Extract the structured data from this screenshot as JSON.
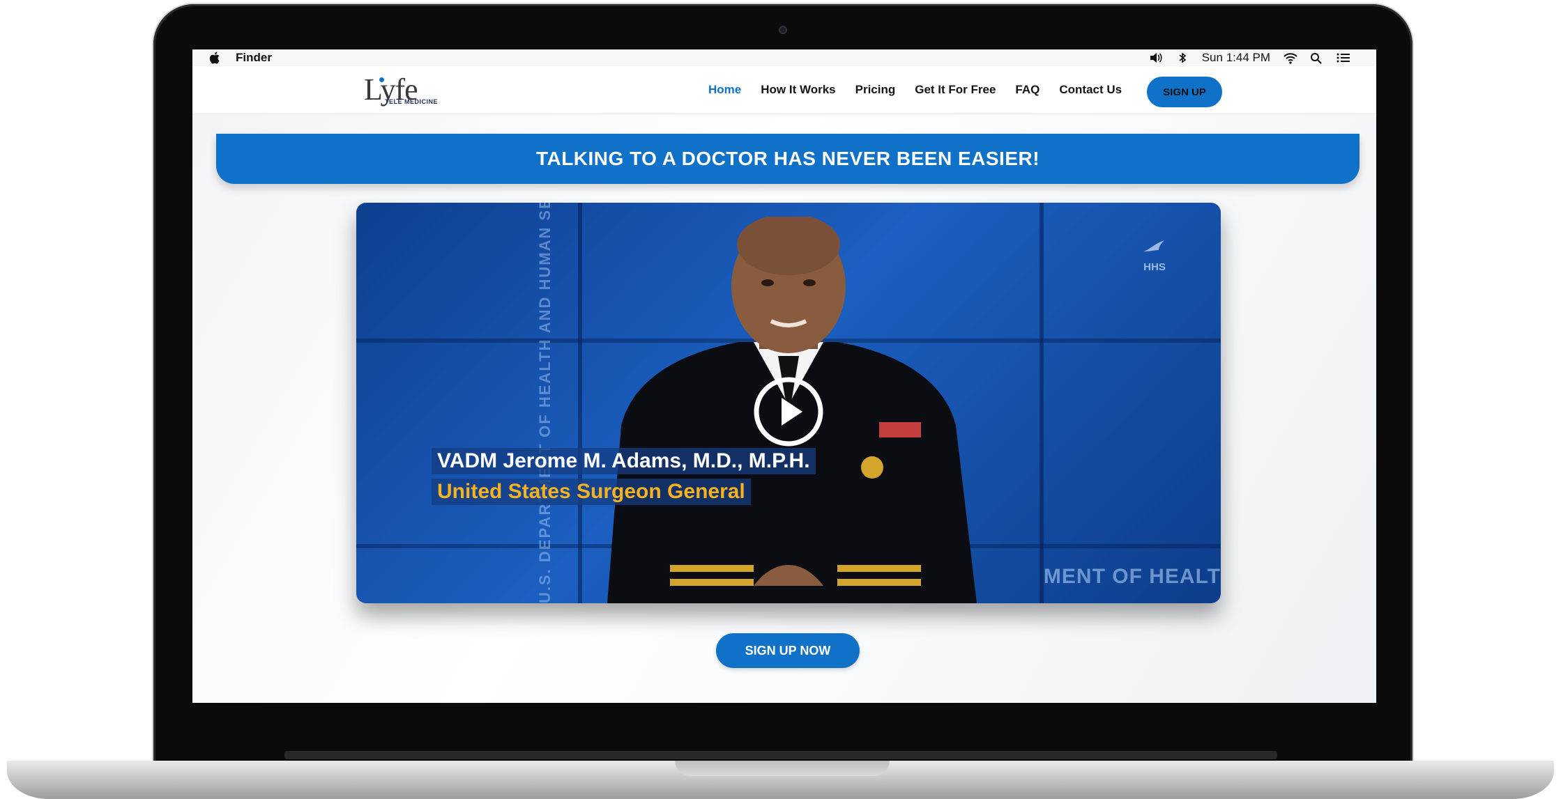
{
  "menubar": {
    "app_name": "Finder",
    "clock": "Sun 1:44 PM"
  },
  "site": {
    "logo": {
      "main": "Lyfe",
      "sub": "TELE MEDICINE"
    },
    "nav": [
      {
        "label": "Home",
        "active": true
      },
      {
        "label": "How It Works",
        "active": false
      },
      {
        "label": "Pricing",
        "active": false
      },
      {
        "label": "Get It For Free",
        "active": false
      },
      {
        "label": "FAQ",
        "active": false
      },
      {
        "label": "Contact Us",
        "active": false
      }
    ],
    "signup_label": "SIGN UP"
  },
  "hero": {
    "banner": "TALKING TO A DOCTOR HAS NEVER BEEN EASIER!",
    "video": {
      "caption_name": "VADM Jerome M. Adams, M.D., M.P.H.",
      "caption_title": "United States Surgeon General",
      "side_watermark": "U.S. DEPARTMENT OF HEALTH AND HUMAN SERVICES",
      "bottom_watermark": "MENT OF HEALT",
      "logo_text": "HHS"
    },
    "cta": "SIGN UP NOW"
  },
  "colors": {
    "brand_blue": "#0f72c8",
    "caption_gold": "#f6b21f"
  },
  "icons": [
    "apple-icon",
    "volume-icon",
    "bluetooth-icon",
    "wifi-icon",
    "search-icon",
    "menu-list-icon",
    "play-icon"
  ]
}
